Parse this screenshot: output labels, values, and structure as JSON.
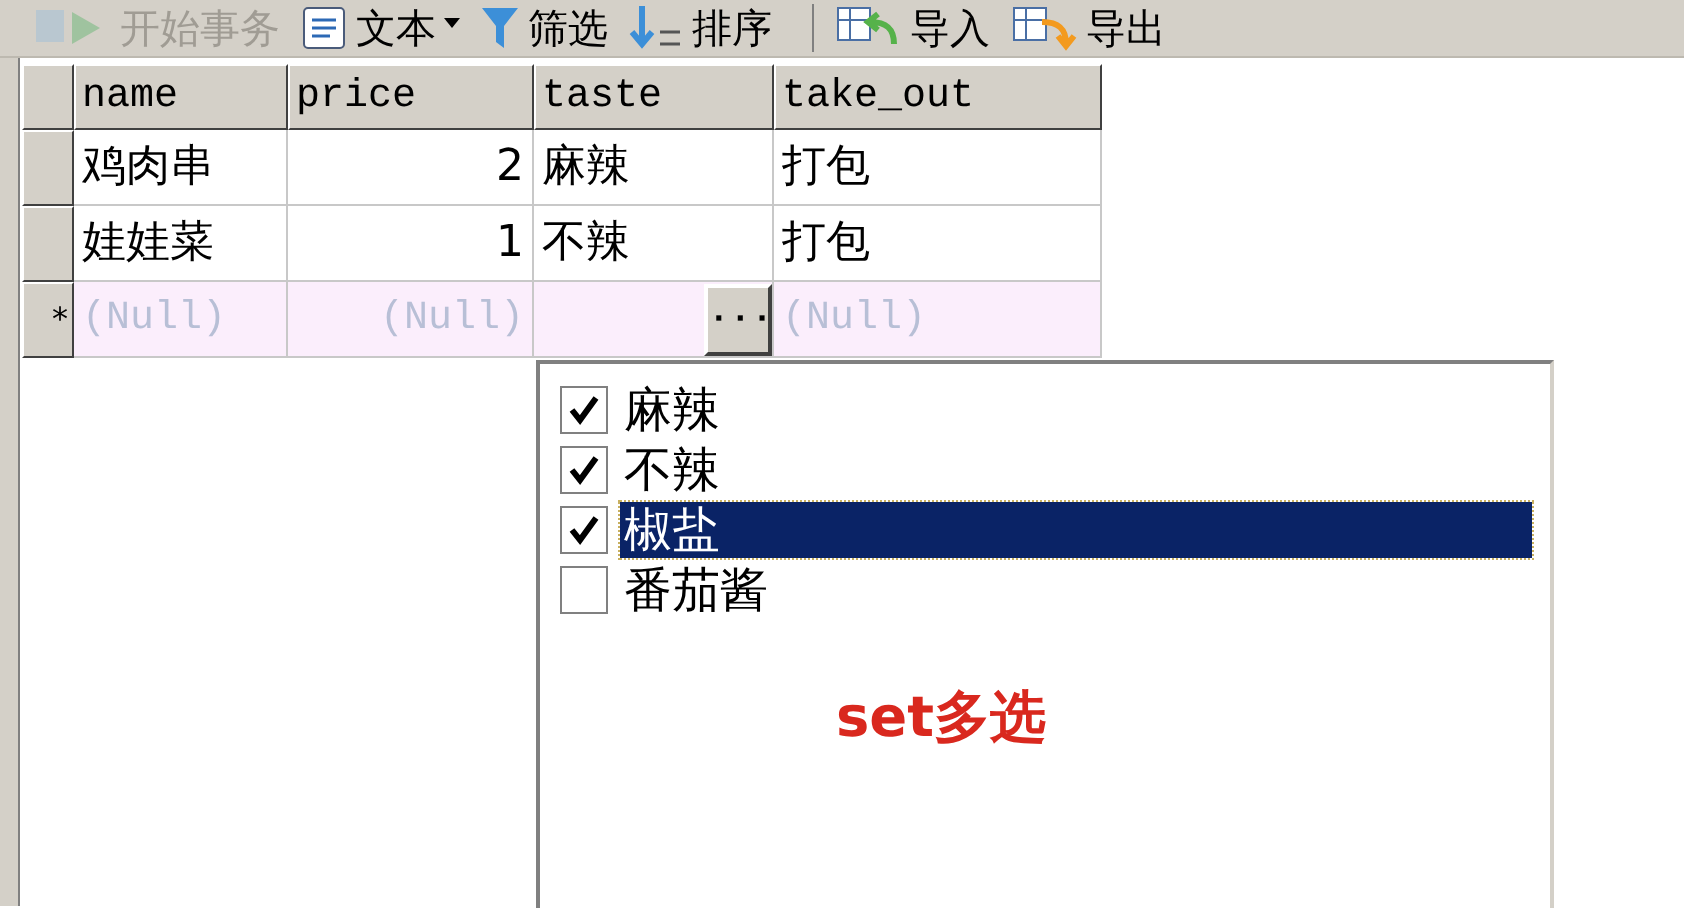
{
  "toolbar": {
    "buttons": [
      {
        "label": "开始事务",
        "kind": "transaction",
        "disabled": true
      },
      {
        "label": "文本",
        "kind": "text",
        "disabled": false
      },
      {
        "label": "筛选",
        "kind": "filter",
        "disabled": false
      },
      {
        "label": "排序",
        "kind": "sort",
        "disabled": false
      },
      {
        "label": "导入",
        "kind": "import",
        "disabled": false
      },
      {
        "label": "导出",
        "kind": "export",
        "disabled": false
      }
    ]
  },
  "table": {
    "columns": [
      {
        "label": "name",
        "kind": "text"
      },
      {
        "label": "price",
        "kind": "number"
      },
      {
        "label": "taste",
        "kind": "text"
      },
      {
        "label": "take_out",
        "kind": "text"
      }
    ],
    "rows": [
      [
        "鸡肉串",
        "2",
        "麻辣",
        "打包"
      ],
      [
        "娃娃菜",
        "1",
        "不辣",
        "打包"
      ]
    ],
    "new_row": {
      "marker": "*",
      "cells": [
        "(Null)",
        "(Null)",
        "",
        "(Null)"
      ],
      "edit_button": "···"
    }
  },
  "set_picker": {
    "items": [
      {
        "label": "麻辣",
        "checked": true,
        "selected": false
      },
      {
        "label": "不辣",
        "checked": true,
        "selected": false
      },
      {
        "label": "椒盐",
        "checked": true,
        "selected": true
      },
      {
        "label": "番茄酱",
        "checked": false,
        "selected": false
      }
    ]
  },
  "annotation": "set多选"
}
